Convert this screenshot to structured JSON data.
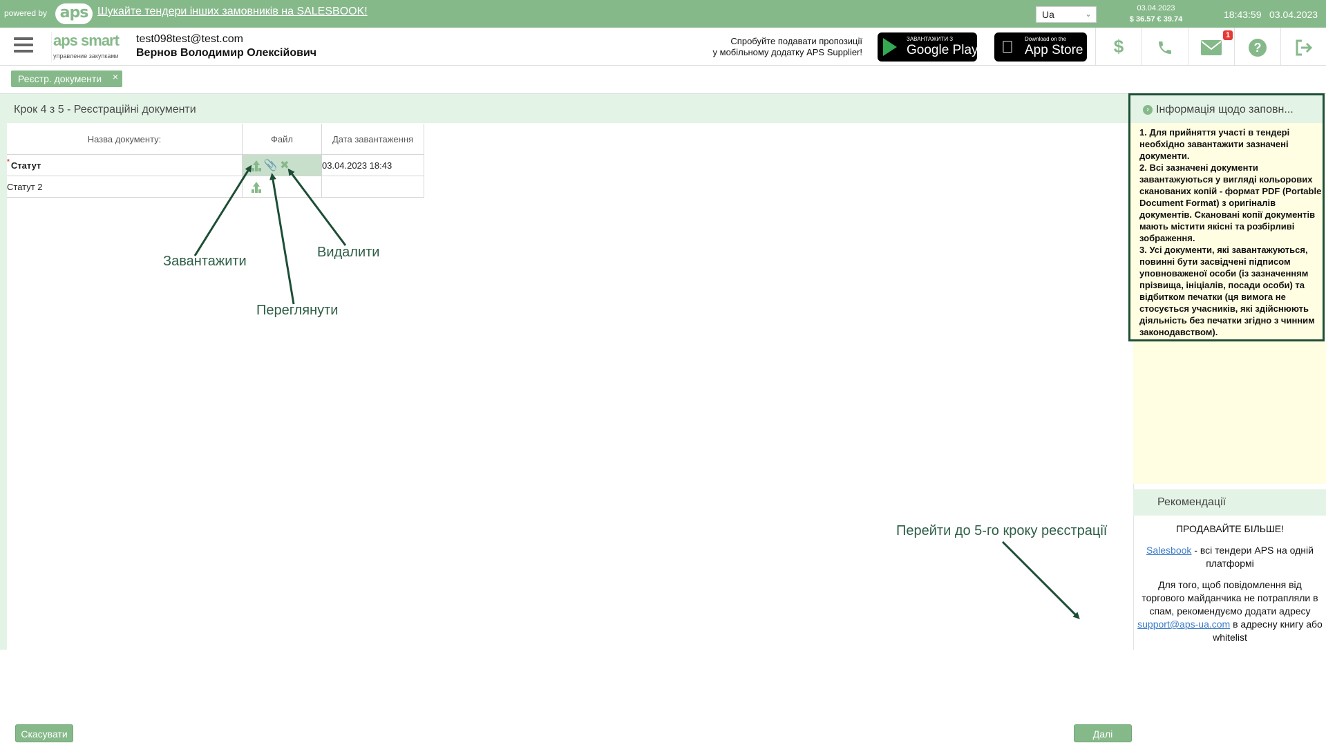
{
  "topbar": {
    "powered_by": "powered by",
    "logo_text": "aps",
    "promo_link": "Шукайте тендери інших замовників на SALESBOOK!",
    "language": "Ua",
    "rates_date": "03.04.2023",
    "rates": "$ 36.57  € 39.74",
    "time": "18:43:59",
    "date": "03.04.2023"
  },
  "header": {
    "logo_text": "aps smart",
    "logo_sub": "управление закупками",
    "user_email": "test098test@test.com",
    "user_name": "Вернов Володимир Олексійович",
    "mobile_line1": "Спробуйте подавати пропозиції",
    "mobile_line2": "у мобільному додатку APS Supplier!",
    "google_small": "ЗАВАНТАЖИТИ З",
    "google_big": "Google Play",
    "apple_small": "Download on the",
    "apple_big": "App Store",
    "mail_badge": "1",
    "icons": [
      "dollar-icon",
      "phone-icon",
      "mail-icon",
      "help-icon",
      "logout-icon"
    ]
  },
  "tabs": [
    {
      "label": "Реєстр. документи"
    }
  ],
  "main": {
    "step_title": "Крок 4 з 5 - Реєстраційні документи",
    "columns": [
      "Назва документу:",
      "Файл",
      "Дата завантаження"
    ],
    "rows": [
      {
        "name": "Статут",
        "required": true,
        "date": "03.04.2023 18:43"
      },
      {
        "name": "Статут 2",
        "required": false,
        "date": ""
      }
    ],
    "annotations": {
      "upload": "Завантажити",
      "delete": "Видалити",
      "view": "Переглянути",
      "next_step": "Перейти до 5-го кроку реєстрації"
    },
    "cancel_button": "Скасувати",
    "next_button": "Далі"
  },
  "info_panel": {
    "title": "Інформація щодо заповн...",
    "text": "1. Для прийняття участі в тендері необхідно завантажити зазначені документи.\n2. Всі зазначені документи завантажуються у вигляді кольорових сканованих копій - формат PDF (Portable Document Format) з оригіналів документів. Скановані копії документів мають містити якісні та розбірливі зображення.\n3. Усі документи, які завантажуються, повинні бути засвідчені підписом уповноваженої особи (із зазначенням прізвища, ініціалів, посади особи) та відбитком печатки (ця вимога не стосується учасників, які здійснюють діяльність без печатки згідно з чинним законодавством)."
  },
  "recommendations": {
    "title": "Рекомендації",
    "sell_more": "ПРОДАВАЙТЕ БІЛЬШЕ!",
    "salesbook_link": "Salesbook",
    "salesbook_text": " - всі тендери APS на одній платформі",
    "spam_text_1": "Для того, щоб повідомлення від торгового майданчика не потрапляли в спам, рекомендуємо додати адресу ",
    "support_link": "support@aps-ua.com",
    "spam_text_2": " в адресну книгу або whitelist"
  },
  "colors": {
    "accent": "#86b98a",
    "light_accent": "#e3f3e6",
    "annotation": "#1d4e36",
    "info_bg": "#fffde2"
  }
}
